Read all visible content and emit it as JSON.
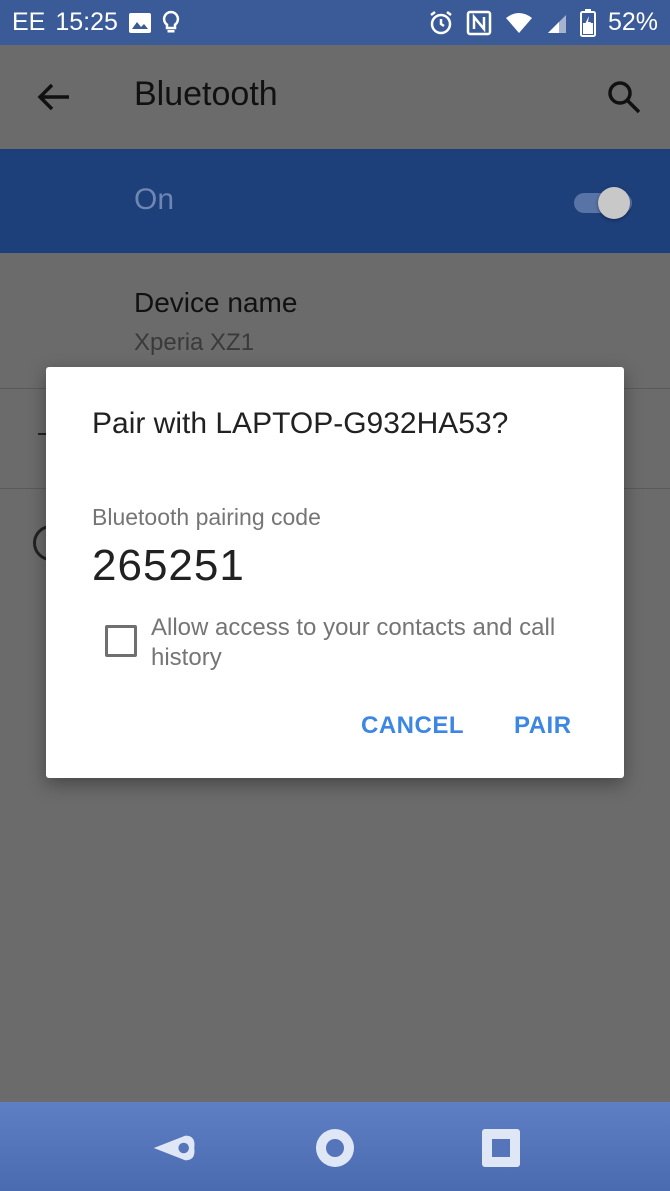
{
  "status_bar": {
    "carrier": "EE",
    "time": "15:25",
    "battery": "52%"
  },
  "app_bar": {
    "title": "Bluetooth"
  },
  "toggle_row": {
    "label": "On",
    "checked": true
  },
  "settings": {
    "device_name_title": "Device name",
    "device_name_value": "Xperia XZ1"
  },
  "dialog": {
    "title": "Pair with LAPTOP-G932HA53?",
    "code_label": "Bluetooth pairing code",
    "code": "265251",
    "checkbox_label": "Allow access to your contacts and call history",
    "checkbox_checked": false,
    "cancel_label": "CANCEL",
    "pair_label": "PAIR"
  },
  "colors": {
    "status_bar": "#3a5a98",
    "accent": "#3d87e3",
    "scrim": "#6b6b6b"
  },
  "icons": {
    "back": "arrow-left-icon",
    "search": "search-icon",
    "nav_back": "nav-back-icon",
    "nav_home": "nav-home-icon",
    "nav_recent": "nav-recent-icon"
  }
}
